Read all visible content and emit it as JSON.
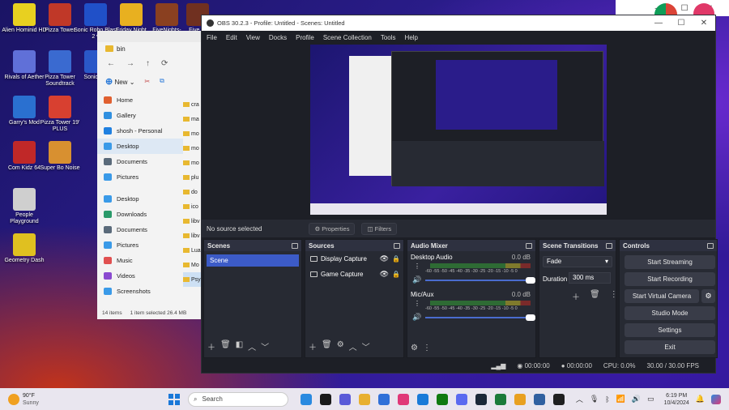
{
  "desktop": {
    "icons": [
      {
        "label": "Alien Hominid HD",
        "color": "#e8d020"
      },
      {
        "label": "Pizza Tower",
        "color": "#c03828"
      },
      {
        "label": "Sonic Robo Blast 2 v",
        "color": "#2050c8"
      },
      {
        "label": "Friday Night",
        "color": "#e8b020"
      },
      {
        "label": "FiveNights-",
        "color": "#8a4020"
      },
      {
        "label": "Five Ni",
        "color": "#703020"
      },
      {
        "label": "Rivals of Aether",
        "color": "#6070d8"
      },
      {
        "label": "Pizza Tower Soundtrack",
        "color": "#3a6ad0"
      },
      {
        "label": "Sonic Ma",
        "color": "#2a58c8"
      },
      {
        "label": "Garry's Mod",
        "color": "#2a70d0"
      },
      {
        "label": "Pizza Tower 19' PLUS",
        "color": "#d84030"
      },
      {
        "label": "Com Kidz 64",
        "color": "#c02828"
      },
      {
        "label": "Super Bo Noise",
        "color": "#d89030"
      },
      {
        "label": "People Playground",
        "color": "#cfcfcf"
      },
      {
        "label": "Geometry Dash",
        "color": "#e0c020"
      }
    ]
  },
  "explorer": {
    "address": "bin",
    "new_label": "New",
    "nav": [
      {
        "label": "Home",
        "color": "#e06030"
      },
      {
        "label": "Gallery",
        "color": "#3090e0"
      },
      {
        "label": "shosh - Personal",
        "color": "#2080e0"
      },
      {
        "label": "Desktop",
        "color": "#3a9ae8"
      },
      {
        "label": "Documents",
        "color": "#5a6a7a"
      },
      {
        "label": "Pictures",
        "color": "#3a9ae8"
      },
      {
        "label": "Desktop",
        "color": "#3a9ae8"
      },
      {
        "label": "Downloads",
        "color": "#2a9a6a"
      },
      {
        "label": "Documents",
        "color": "#5a6a7a"
      },
      {
        "label": "Pictures",
        "color": "#3a9ae8"
      },
      {
        "label": "Music",
        "color": "#e05050"
      },
      {
        "label": "Videos",
        "color": "#8a4ad0"
      },
      {
        "label": "Screenshots",
        "color": "#3a9ae8"
      }
    ],
    "files": [
      "cra",
      "ma",
      "mo",
      "mo",
      "mo",
      "plu",
      "do",
      "ico",
      "libv",
      "libv",
      "Lua",
      "Mo",
      "Psy"
    ],
    "status": "14 items",
    "status_sel": "1 item selected  26.4 MB"
  },
  "obs": {
    "title": "OBS 30.2.3 - Profile: Untitled - Scenes: Untitled",
    "menu": [
      "File",
      "Edit",
      "View",
      "Docks",
      "Profile",
      "Scene Collection",
      "Tools",
      "Help"
    ],
    "no_source": "No source selected",
    "properties": "Properties",
    "filters": "Filters",
    "scenes": {
      "title": "Scenes",
      "items": [
        "Scene"
      ]
    },
    "sources": {
      "title": "Sources",
      "items": [
        "Display Capture",
        "Game Capture"
      ]
    },
    "mixer": {
      "title": "Audio Mixer",
      "tracks": [
        {
          "name": "Desktop Audio",
          "db": "0.0 dB"
        },
        {
          "name": "Mic/Aux",
          "db": "0.0 dB"
        }
      ],
      "ticks": "-60 -55 -50 -45 -40 -35 -30 -25 -20 -15 -10 -5 0"
    },
    "transitions": {
      "title": "Scene Transitions",
      "type": "Fade",
      "duration_label": "Duration",
      "duration": "300 ms"
    },
    "controls": {
      "title": "Controls",
      "buttons": [
        "Start Streaming",
        "Start Recording",
        "Start Virtual Camera",
        "Studio Mode",
        "Settings",
        "Exit"
      ]
    },
    "status": {
      "rec": "00:00:00",
      "stream": "00:00:00",
      "cpu": "CPU: 0.0%",
      "fps": "30.00 / 30.00 FPS"
    }
  },
  "taskbar": {
    "weather": "90°F",
    "weather_desc": "Sunny",
    "search": "Search",
    "time": "6:19 PM",
    "date": "10/4/2024",
    "apps": [
      {
        "color": "#2a8ae0"
      },
      {
        "color": "#1a1a1a"
      },
      {
        "color": "#5a5ad8"
      },
      {
        "color": "#e8b030"
      },
      {
        "color": "#3070d8"
      },
      {
        "color": "#e03878"
      },
      {
        "color": "#1a7ad8"
      },
      {
        "color": "#107a10"
      },
      {
        "color": "#5a6af0"
      },
      {
        "color": "#1b2838"
      },
      {
        "color": "#1a7a3a"
      },
      {
        "color": "#e8a020"
      },
      {
        "color": "#3060a0"
      },
      {
        "color": "#202020"
      }
    ]
  }
}
